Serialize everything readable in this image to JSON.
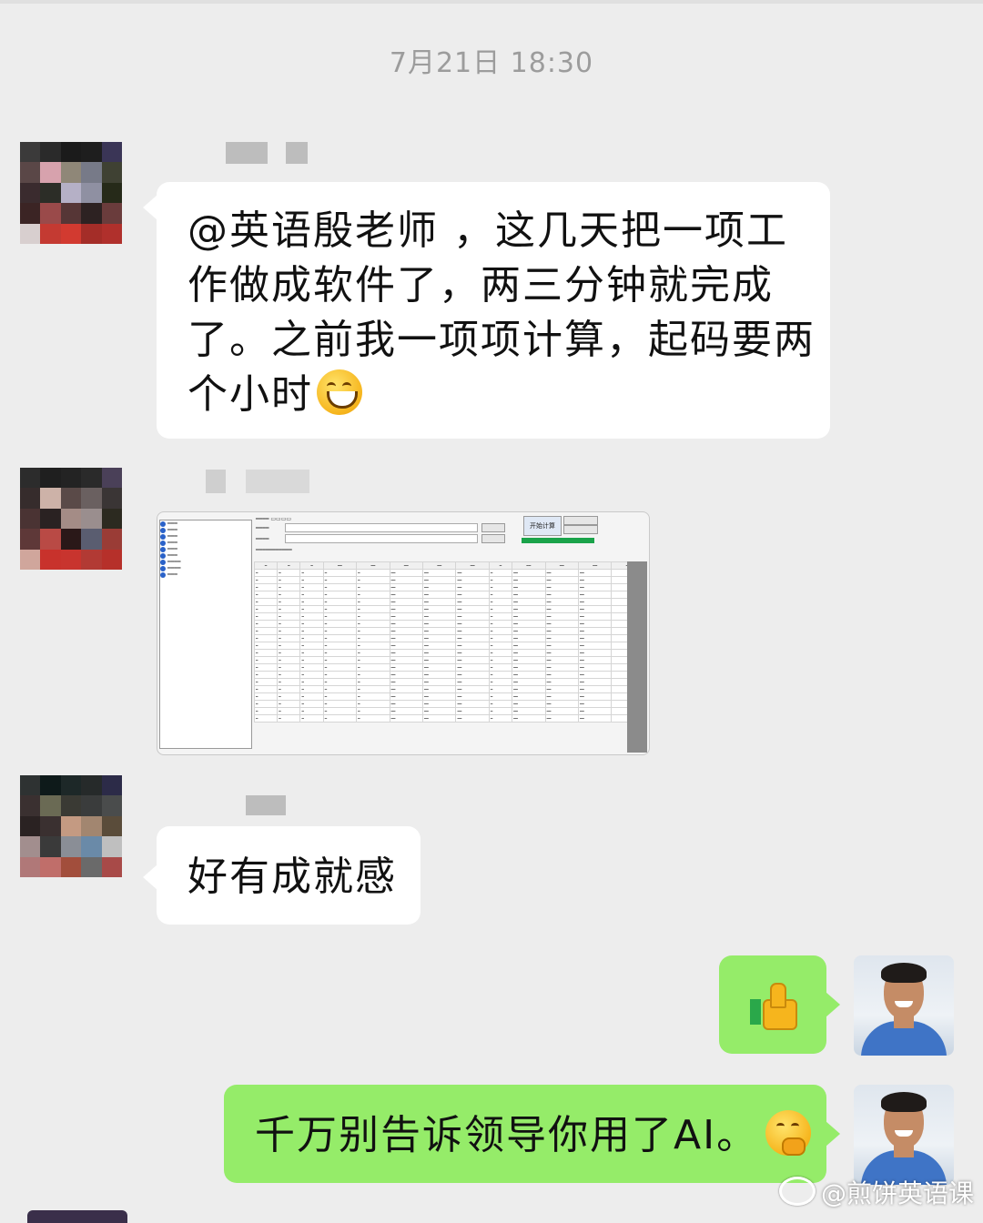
{
  "timestamp": "7月21日 18:30",
  "messages": [
    {
      "text": "@英语殷老师 ，这几天把一项工作做成软件了，两三分钟就完成了。之前我一项项计算，起码要两个小时"
    },
    {
      "image": "software-screenshot"
    },
    {
      "text": "好有成就感"
    },
    {
      "emoji": "thumbs-up-icon"
    },
    {
      "text": "千万别告诉领导你用了AI。"
    }
  ],
  "screenshot": {
    "ui_font_note": "tiny embedded application screenshot",
    "start_button": "开始计算",
    "accent_progress": "#1aa34a"
  },
  "watermark": "@煎饼英语课",
  "colors": {
    "background": "#ededed",
    "my_bubble": "#95ec69",
    "other_bubble": "#ffffff"
  }
}
